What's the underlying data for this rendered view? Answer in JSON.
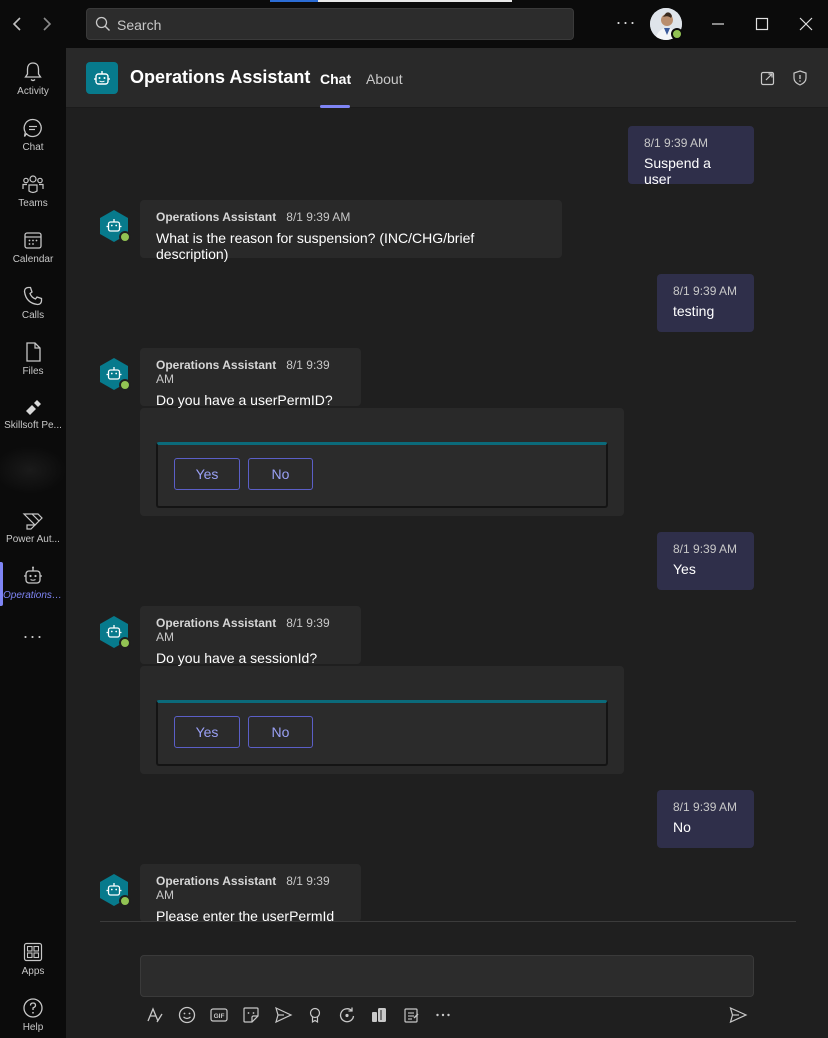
{
  "titlebar": {
    "back_label": "‹",
    "forward_label": "›",
    "search_placeholder": "Search",
    "more_label": "···"
  },
  "rail": {
    "items": [
      {
        "label": "Activity"
      },
      {
        "label": "Chat"
      },
      {
        "label": "Teams"
      },
      {
        "label": "Calendar"
      },
      {
        "label": "Calls"
      },
      {
        "label": "Files"
      },
      {
        "label": "Skillsoft Pe..."
      },
      {
        "label": "Power Aut..."
      },
      {
        "label": "Operations ..."
      },
      {
        "label": "Apps"
      },
      {
        "label": "Help"
      }
    ],
    "more_label": "···"
  },
  "app": {
    "title": "Operations Assistant",
    "tabs": [
      {
        "label": "Chat"
      },
      {
        "label": "About"
      }
    ]
  },
  "messages": [
    {
      "type": "sent",
      "time": "8/1 9:39 AM",
      "text": "Suspend a user"
    },
    {
      "type": "received",
      "name": "Operations Assistant",
      "time": "8/1 9:39 AM",
      "text": "What is the reason for suspension? (INC/CHG/brief description)"
    },
    {
      "type": "sent",
      "time": "8/1 9:39 AM",
      "text": "testing"
    },
    {
      "type": "received",
      "name": "Operations Assistant",
      "time": "8/1 9:39 AM",
      "text": "Do you have a userPermID?"
    },
    {
      "type": "card",
      "buttons": [
        "Yes",
        "No"
      ]
    },
    {
      "type": "sent",
      "time": "8/1 9:39 AM",
      "text": "Yes"
    },
    {
      "type": "received",
      "name": "Operations Assistant",
      "time": "8/1 9:39 AM",
      "text": "Do you have a sessionId?"
    },
    {
      "type": "card",
      "buttons": [
        "Yes",
        "No"
      ]
    },
    {
      "type": "sent",
      "time": "8/1 9:39 AM",
      "text": "No"
    },
    {
      "type": "received",
      "name": "Operations Assistant",
      "time": "8/1 9:39 AM",
      "text": "Please enter the userPermId"
    }
  ],
  "colors": {
    "accent": "#7f85f5",
    "bot_teal": "#077a8c",
    "presence_green": "#92c353",
    "sent_bubble": "#2f2f4a",
    "received_bubble": "#292929"
  }
}
